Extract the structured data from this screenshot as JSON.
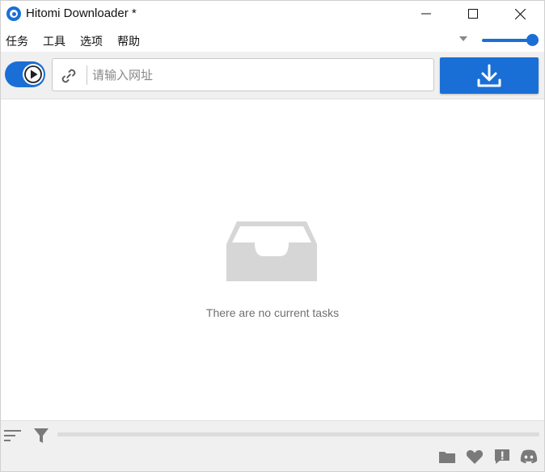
{
  "window": {
    "title": "Hitomi Downloader *",
    "controls": [
      "minimize-icon",
      "maximize-icon",
      "close-icon"
    ]
  },
  "menu": {
    "items": [
      {
        "label": "任务"
      },
      {
        "label": "工具"
      },
      {
        "label": "选项"
      },
      {
        "label": "帮助"
      }
    ],
    "dropdown_icon": "chevron-down-icon",
    "slider_value": 1.0
  },
  "toolbar": {
    "toggle_state": "on",
    "toggle_icon": "play-icon",
    "link_icon": "link-icon",
    "url": {
      "value": "",
      "placeholder": "请输入网址"
    },
    "download_icon": "download-icon"
  },
  "main": {
    "empty_icon": "inbox-tray-icon",
    "empty_message": "There are no current tasks"
  },
  "bottom": {
    "left_icons": [
      "sort-icon",
      "filter-icon"
    ],
    "progress": 0,
    "right_icons": [
      "folder-icon",
      "heart-icon",
      "feedback-icon",
      "discord-icon"
    ]
  },
  "colors": {
    "accent": "#1a6fd6",
    "toolbar_bg": "#f0f0f0",
    "icon_gray": "#7a7a7a",
    "empty_icon_gray": "#d6d6d6"
  }
}
